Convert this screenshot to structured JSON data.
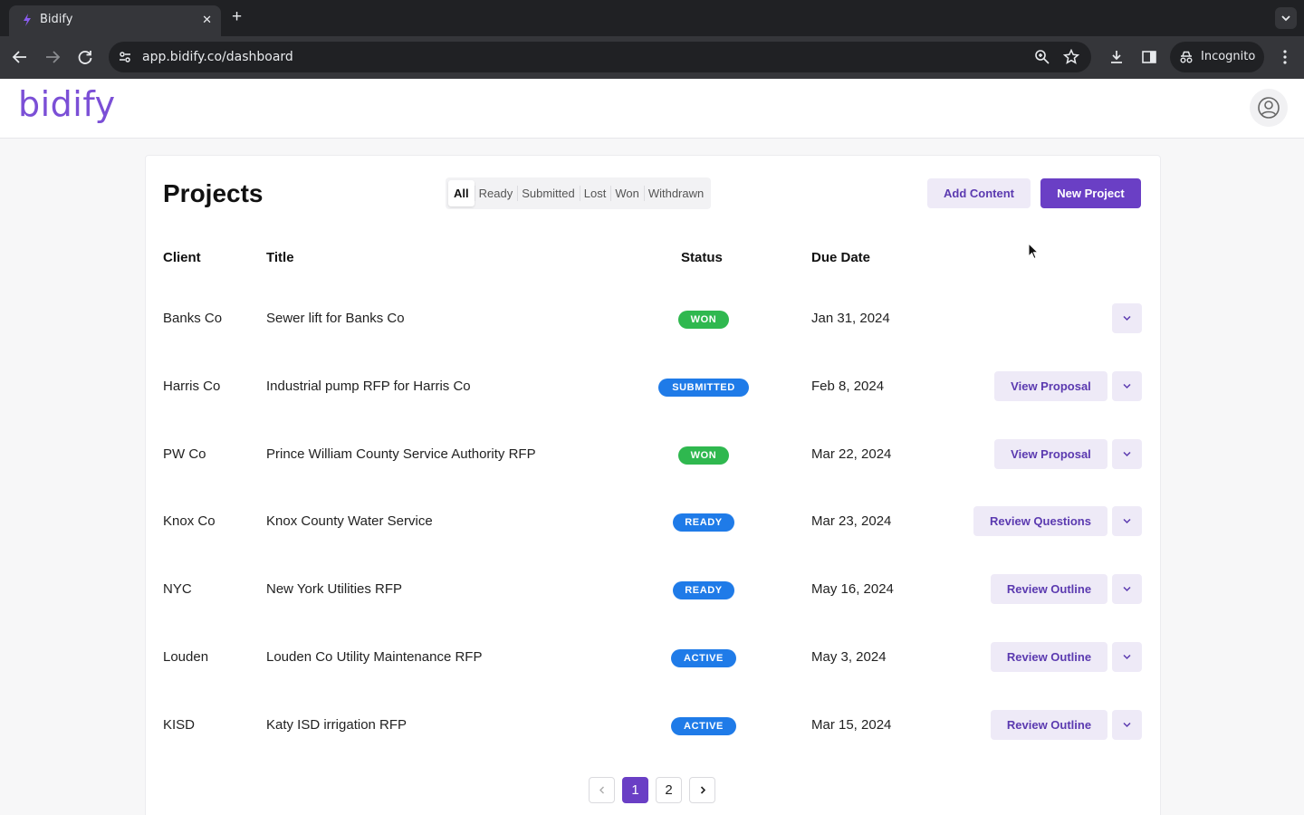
{
  "browser": {
    "tab_title": "Bidify",
    "tab_close": "✕",
    "new_tab": "+",
    "url": "app.bidify.co/dashboard",
    "incognito_label": "Incognito"
  },
  "app": {
    "logo": "bidify",
    "accent_color": "#6a3fc5"
  },
  "page": {
    "title": "Projects",
    "filters": [
      "All",
      "Ready",
      "Submitted",
      "Lost",
      "Won",
      "Withdrawn"
    ],
    "active_filter": "All",
    "add_content_label": "Add Content",
    "new_project_label": "New Project"
  },
  "table": {
    "headers": {
      "client": "Client",
      "title": "Title",
      "status": "Status",
      "due": "Due Date"
    },
    "rows": [
      {
        "client": "Banks Co",
        "title": "Sewer lift for Banks Co",
        "status": "WON",
        "status_color": "#2fb84f",
        "due": "Jan 31, 2024",
        "action": ""
      },
      {
        "client": "Harris Co",
        "title": "Industrial pump RFP for Harris Co",
        "status": "SUBMITTED",
        "status_color": "#1f7be8",
        "due": "Feb 8, 2024",
        "action": "View Proposal"
      },
      {
        "client": "PW Co",
        "title": "Prince William County Service Authority RFP",
        "status": "WON",
        "status_color": "#2fb84f",
        "due": "Mar 22, 2024",
        "action": "View Proposal"
      },
      {
        "client": "Knox Co",
        "title": "Knox County Water Service",
        "status": "READY",
        "status_color": "#1f7be8",
        "due": "Mar 23, 2024",
        "action": "Review Questions"
      },
      {
        "client": "NYC",
        "title": "New York Utilities RFP",
        "status": "READY",
        "status_color": "#1f7be8",
        "due": "May 16, 2024",
        "action": "Review Outline"
      },
      {
        "client": "Louden",
        "title": "Louden Co Utility Maintenance RFP",
        "status": "ACTIVE",
        "status_color": "#1f7be8",
        "due": "May 3, 2024",
        "action": "Review Outline"
      },
      {
        "client": "KISD",
        "title": "Katy ISD irrigation RFP",
        "status": "ACTIVE",
        "status_color": "#1f7be8",
        "due": "Mar 15, 2024",
        "action": "Review Outline"
      }
    ]
  },
  "pagination": {
    "pages": [
      "1",
      "2"
    ],
    "current": "1"
  }
}
